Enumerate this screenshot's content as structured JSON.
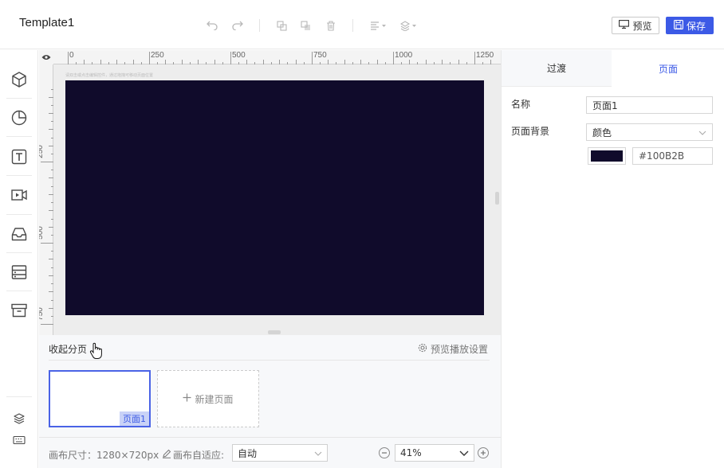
{
  "header": {
    "title": "Template1",
    "preview_label": "预览",
    "save_label": "保存"
  },
  "canvas": {
    "ruler_top": [
      "0",
      "250",
      "500",
      "750",
      "1000",
      "1250"
    ],
    "ruler_left": [
      "250",
      "500",
      "750"
    ],
    "hint": "请双击或点击编辑控件，通过拖拽可移动页面位置",
    "background_color": "#100B2B"
  },
  "pages_panel": {
    "collapse_label": "收起分页",
    "play_settings_label": "预览播放设置",
    "pages": [
      {
        "label": "页面1"
      }
    ],
    "new_page_label": "新建页面"
  },
  "bottom_bar": {
    "canvas_size_label": "画布尺寸：1280×720px",
    "fit_label": "画布自适应:",
    "fit_value": "自动",
    "zoom_value": "41%"
  },
  "right_panel": {
    "tabs": [
      "过渡",
      "页面"
    ],
    "active_tab": "页面",
    "name_label": "名称",
    "name_value": "页面1",
    "bg_label": "页面背景",
    "bg_type": "颜色",
    "bg_color": "#100B2B"
  },
  "colors": {
    "accent": "#3c5ae6",
    "canvas_bg": "#100B2B"
  }
}
